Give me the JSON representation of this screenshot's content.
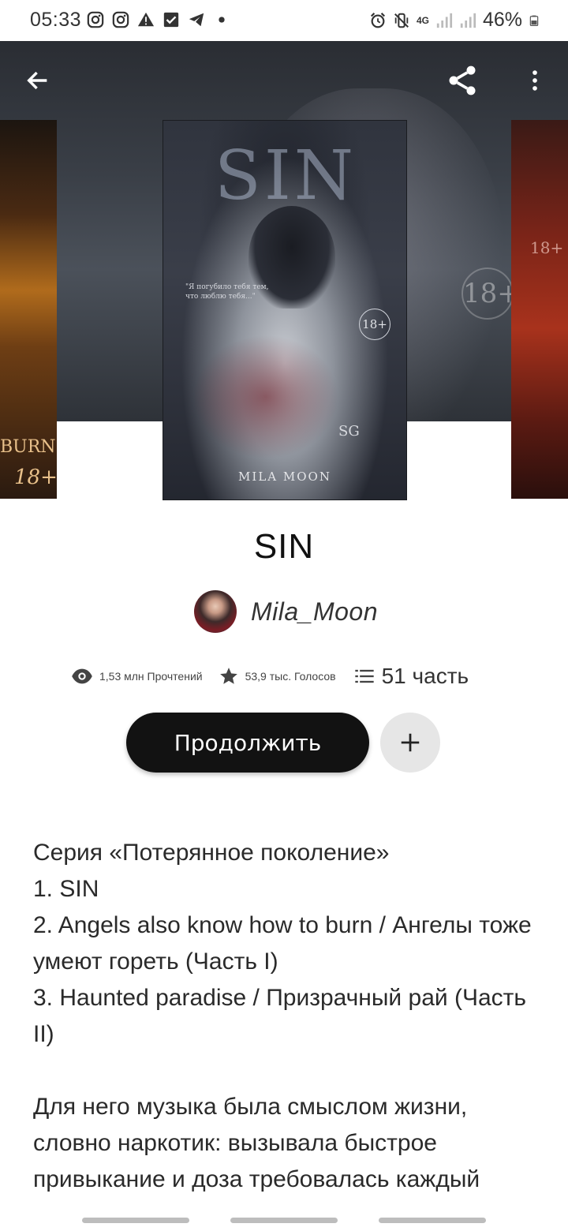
{
  "status_bar": {
    "time": "05:33",
    "battery": "46%",
    "network": "4G"
  },
  "top_bar": {
    "back_icon": "arrow-left-icon",
    "share_icon": "share-icon",
    "more_icon": "more-vertical-icon"
  },
  "covers": {
    "main": {
      "title_art": "SIN",
      "quote": "\"Я погубило тебя тем, что люблю тебя...\"",
      "age": "18+",
      "publisher": "SG",
      "author": "MILA MOON"
    },
    "left": {
      "partial_text": "BURN",
      "age": "18+"
    },
    "right": {
      "age": "18+"
    }
  },
  "book": {
    "title": "SIN",
    "author": "Mila_Moon",
    "reads": "1,53 млн Прочтений",
    "votes": "53,9 тыс. Голосов",
    "parts": "51 часть"
  },
  "actions": {
    "continue_label": "Продолжить",
    "add_icon": "plus-icon"
  },
  "description": {
    "lines": [
      "Серия «Потерянное поколение»",
      "1. SIN",
      "2. Angels also know how to burn / Ангелы тоже умеют гореть  (Часть I)",
      "3. Haunted paradise / Призрачный рай (Часть II)"
    ],
    "paragraph": "Для него музыка была смыслом жизни, словно наркотик: вызывала быстрое привыкание и доза требовалась каждый"
  },
  "colors": {
    "button_dark": "#121212",
    "add_button_bg": "#e6e6e6",
    "text": "#2a2a2a"
  }
}
